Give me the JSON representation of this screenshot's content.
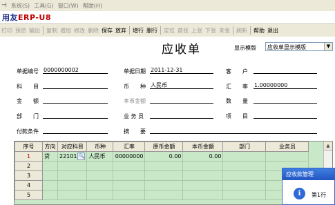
{
  "menubar": {
    "items": [
      "系统(S)",
      "工具(G)",
      "窗口(W)",
      "帮助(H)"
    ]
  },
  "brand": {
    "prefix": "用友",
    "erp": "ERP",
    "suffix": "-U8"
  },
  "toolbar": {
    "buttons": [
      {
        "label": "打印",
        "enabled": false
      },
      {
        "label": "预览",
        "enabled": false
      },
      {
        "label": "输出",
        "enabled": false
      },
      {
        "label": "复制",
        "enabled": false
      },
      {
        "label": "增加",
        "enabled": false
      },
      {
        "label": "修改",
        "enabled": false
      },
      {
        "label": "删除",
        "enabled": false
      },
      {
        "label": "保存",
        "enabled": true
      },
      {
        "label": "放弃",
        "enabled": true
      },
      {
        "label": "增行",
        "enabled": true
      },
      {
        "label": "删行",
        "enabled": true
      },
      {
        "label": "定位",
        "enabled": false
      },
      {
        "label": "首张",
        "enabled": false
      },
      {
        "label": "上张",
        "enabled": false
      },
      {
        "label": "下张",
        "enabled": false
      },
      {
        "label": "末张",
        "enabled": false
      },
      {
        "label": "刷新",
        "enabled": false
      },
      {
        "label": "帮助",
        "enabled": true
      },
      {
        "label": "退出",
        "enabled": true
      }
    ]
  },
  "header": {
    "title": "应收单",
    "template_label": "显示模版",
    "template_value": "应收单显示模版"
  },
  "form": {
    "doc_no_label": "单据编号",
    "doc_no": "0000000002",
    "doc_date_label": "单据日期",
    "doc_date": "2011-12-31",
    "customer_label": "客　　户",
    "customer": "",
    "subject_label": "科　　目",
    "subject": "",
    "currency_label": "币　　种",
    "currency": "人民币",
    "rate_label": "汇　　率",
    "rate": "1.00000000",
    "amount_label": "金　　额",
    "amount": "",
    "local_amount_label": "本币金额",
    "local_amount": "",
    "qty_label": "数　　量",
    "qty": "",
    "dept_label": "部　　门",
    "dept": "",
    "staff_label": "业 务 员",
    "staff": "",
    "project_label": "项　　目",
    "project": "",
    "payment_label": "付款条件",
    "payment": "",
    "summary_label": "摘　　要",
    "summary": ""
  },
  "grid": {
    "columns": [
      "序号",
      "方向",
      "对应科目",
      "币种",
      "汇率",
      "原币金额",
      "本币金额",
      "部门",
      "业务员"
    ],
    "rows": [
      [
        "1",
        "贷",
        "22101",
        "人民币",
        "00000000",
        "0.00",
        "0.00",
        "",
        ""
      ],
      [
        "2",
        "",
        "",
        "",
        "",
        "",
        "",
        "",
        ""
      ],
      [
        "3",
        "",
        "",
        "",
        "",
        "",
        "",
        "",
        ""
      ],
      [
        "4",
        "",
        "",
        "",
        "",
        "",
        "",
        "",
        ""
      ],
      [
        "5",
        "",
        "",
        "",
        "",
        "",
        "",
        "",
        ""
      ]
    ]
  },
  "dialog": {
    "title": "应收款管理",
    "text": "第1行",
    "icon": "info-icon"
  }
}
